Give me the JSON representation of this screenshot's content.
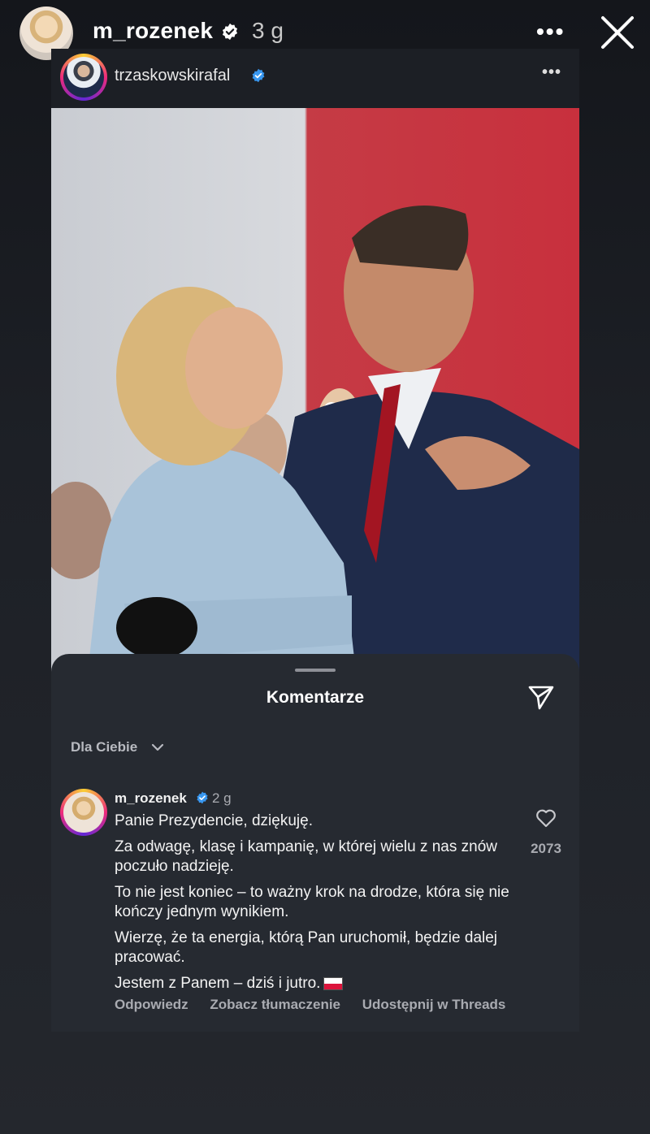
{
  "story": {
    "username": "m_rozenek",
    "time": "3 g",
    "more_label": "•••"
  },
  "post": {
    "username": "trzaskowskirafal",
    "more_label": "•••"
  },
  "comments_sheet": {
    "title": "Komentarze",
    "filter_label": "Dla Ciebie",
    "comment": {
      "username": "m_rozenek",
      "time": "2 g",
      "paragraphs": [
        "Panie Prezydencie, dziękuję.",
        "Za odwagę, klasę i kampanię, w której wielu z nas znów poczuło nadzieję.",
        "To nie jest koniec – to ważny krok na drodze, która się nie kończy jednym wynikiem.",
        "Wierzę, że ta energia, którą Pan uruchomił, będzie dalej pracować.",
        "Jestem z Panem – dziś i jutro."
      ],
      "likes": "2073",
      "actions": {
        "reply": "Odpowiedz",
        "translate": "Zobacz tłumaczenie",
        "share_threads": "Udostępnij w Threads"
      }
    }
  },
  "icons": {
    "verified": "verified-badge-icon",
    "close": "close-icon",
    "send": "send-icon",
    "heart": "heart-icon",
    "chevron": "chevron-down-icon",
    "flag": "poland-flag-icon"
  },
  "colors": {
    "verified": "#3897f0",
    "background": "#1d2026",
    "sheet": "#262a31"
  }
}
